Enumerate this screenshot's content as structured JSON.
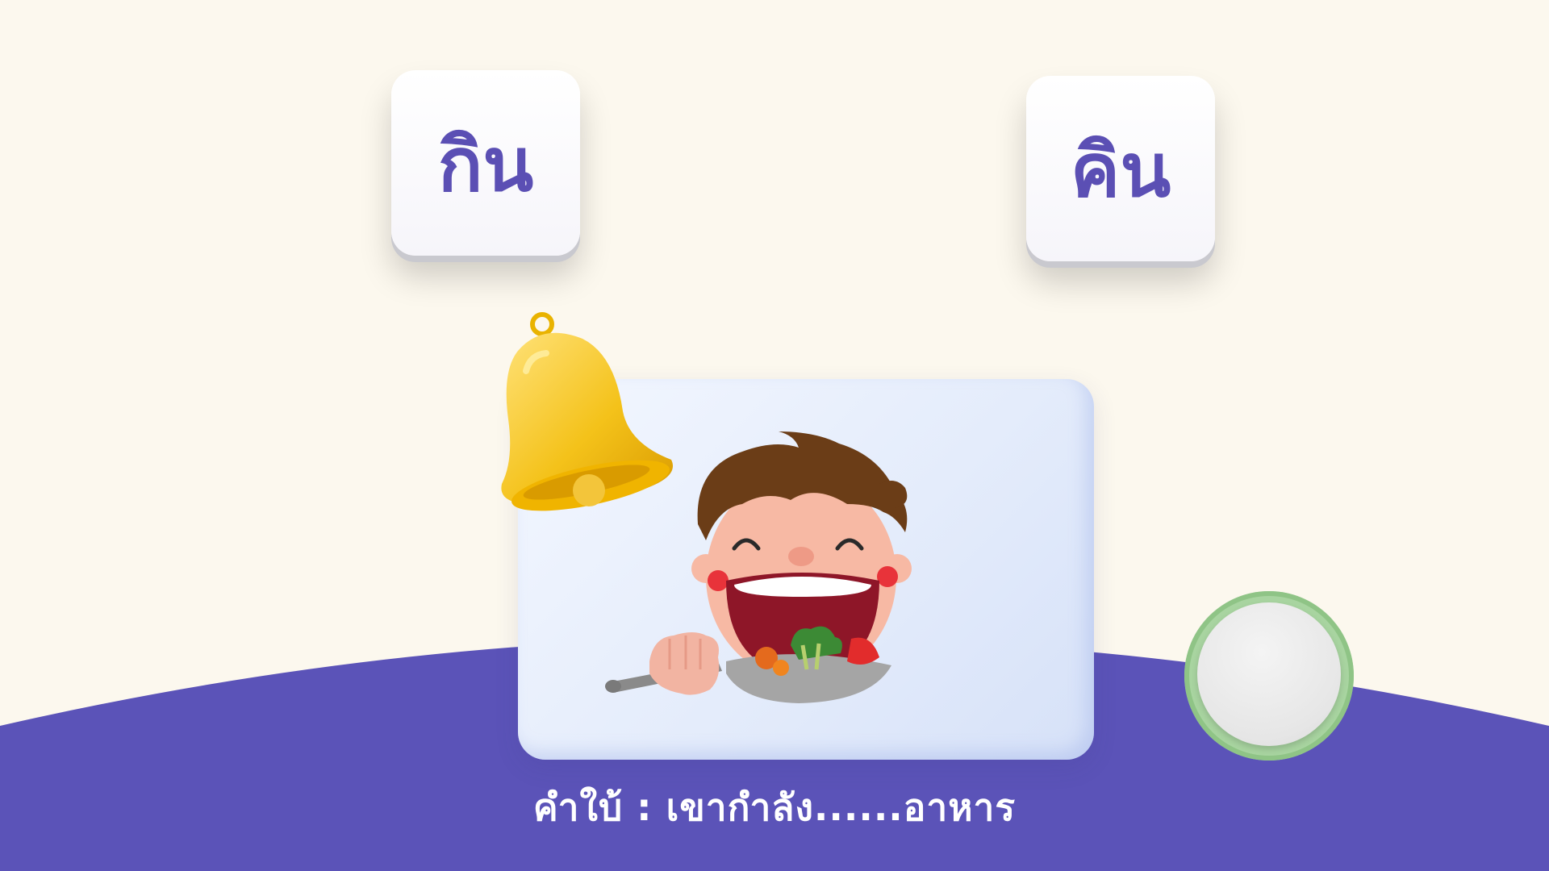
{
  "choices": [
    {
      "label": "กิน"
    },
    {
      "label": "คิน"
    }
  ],
  "picture": {
    "icon": "boy-eating-icon"
  },
  "bell": {
    "icon": "bell-icon"
  },
  "hint": {
    "text": "คำใบ้ : เขากำลัง......อาหาร"
  },
  "colors": {
    "background": "#fcf8ee",
    "hill": "#5b53b8",
    "choice_text": "#5b4fb4",
    "button_ring": "#a8d4a0"
  }
}
